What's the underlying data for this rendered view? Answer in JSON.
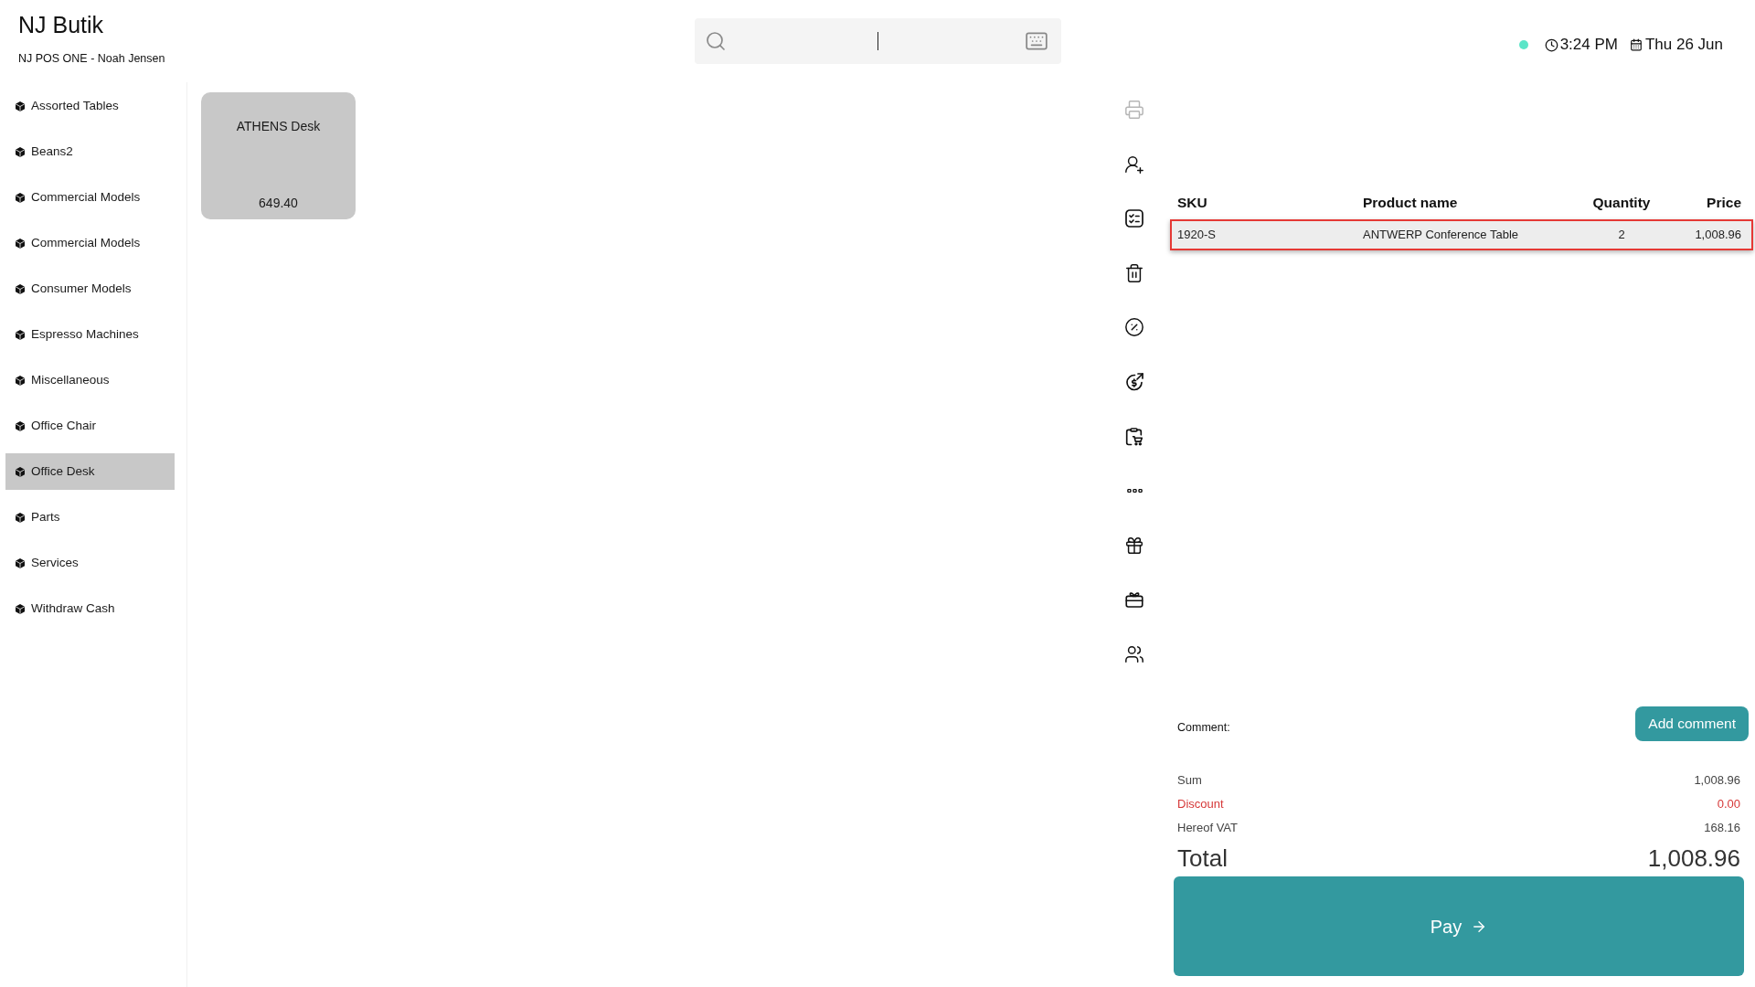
{
  "header": {
    "store_name": "NJ Butik",
    "register": "NJ POS ONE - Noah Jensen"
  },
  "search": {
    "focused": true
  },
  "status": {
    "online": true,
    "time": "3:24 PM",
    "date": "Thu 26 Jun"
  },
  "categories": [
    {
      "label": "Assorted Tables",
      "selected": false
    },
    {
      "label": "Beans2",
      "selected": false
    },
    {
      "label": "Commercial Models",
      "selected": false
    },
    {
      "label": "Commercial Models",
      "selected": false
    },
    {
      "label": "Consumer Models",
      "selected": false
    },
    {
      "label": "Espresso Machines",
      "selected": false
    },
    {
      "label": "Miscellaneous",
      "selected": false
    },
    {
      "label": "Office Chair",
      "selected": false
    },
    {
      "label": "Office Desk",
      "selected": true
    },
    {
      "label": "Parts",
      "selected": false
    },
    {
      "label": "Services",
      "selected": false
    },
    {
      "label": "Withdraw Cash",
      "selected": false
    }
  ],
  "products": [
    {
      "name": "ATHENS Desk",
      "price": "649.40"
    }
  ],
  "actions": [
    {
      "kind": "print",
      "disabled": true
    },
    {
      "kind": "add_customer",
      "disabled": false
    },
    {
      "kind": "checklist",
      "disabled": false
    },
    {
      "kind": "delete",
      "disabled": false
    },
    {
      "kind": "discount",
      "disabled": false
    },
    {
      "kind": "refund",
      "disabled": false
    },
    {
      "kind": "order",
      "disabled": false
    },
    {
      "kind": "more",
      "disabled": false
    },
    {
      "kind": "gift",
      "disabled": false
    },
    {
      "kind": "gift_card",
      "disabled": false
    },
    {
      "kind": "customers",
      "disabled": false
    }
  ],
  "cart": {
    "columns": [
      "SKU",
      "Product name",
      "Quantity",
      "Price"
    ],
    "rows": [
      {
        "sku": "1920-S",
        "product_name": "ANTWERP Conference Table",
        "quantity": "2",
        "price": "1,008.96",
        "selected": true
      }
    ]
  },
  "comment": {
    "label": "Comment:",
    "button": "Add comment"
  },
  "summary": [
    {
      "kind": "plain",
      "label": "Sum",
      "value": "1,008.96"
    },
    {
      "kind": "discount",
      "label": "Discount",
      "value": "0.00"
    },
    {
      "kind": "plain",
      "label": "Hereof VAT",
      "value": "168.16"
    }
  ],
  "total": {
    "label": "Total",
    "value": "1,008.96"
  },
  "pay_button": {
    "label": "Pay"
  }
}
